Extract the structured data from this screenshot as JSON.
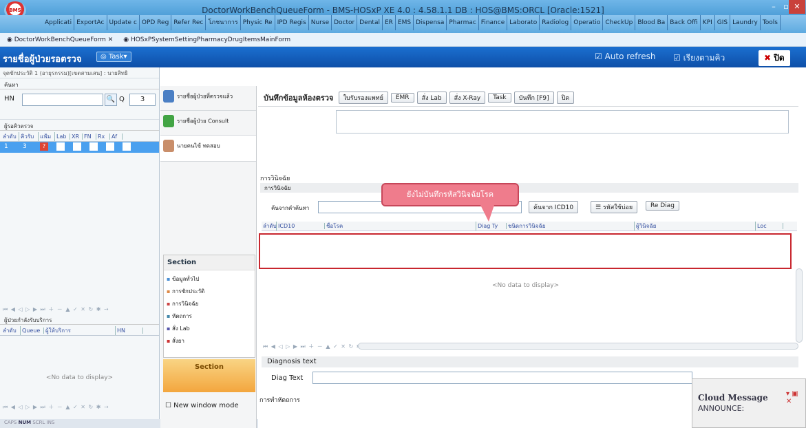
{
  "window": {
    "title": "DoctorWorkBenchQueueForm - BMS-HOSxP XE 4.0 : 4.58.1.1 DB : HOS@BMS:ORCL [Oracle:1521]",
    "logo": "BMS"
  },
  "menu": [
    "Applicati",
    "ExportAc",
    "Update c",
    "OPD Reg",
    "Refer Rec",
    "โภชนาการ",
    "Physic Re",
    "IPD Regis",
    "Nurse",
    "Doctor",
    "Dental",
    "ER",
    "EMS",
    "Dispensa",
    "Pharmac",
    "Finance",
    "Laborato",
    "Radiolog",
    "Operatio",
    "CheckUp",
    "Blood Ba",
    "Back Offi",
    "KPI",
    "GIS",
    "Laundry",
    "Tools"
  ],
  "doc_tabs": [
    "DoctorWorkBenchQueueForm",
    "HOSxPSystemSettingPharmacyDrugItemsMainForm"
  ],
  "header": {
    "title": "รายชื่อผู้ป่วยรอตรวจ",
    "task": "Task",
    "auto_refresh": "Auto refresh",
    "sort_queue": "เรียงตามคิว",
    "close": "ปิด"
  },
  "left": {
    "spclinic": "จุดซักประวัติ 1 (อายุรกรรม)[เขตสามเสน] : นายสิทธิ",
    "search": "ค้นหา",
    "hn_label": "HN",
    "q_label": "Q",
    "q_value": "3",
    "waiting": "ผู้รอคิวตรวจ",
    "grid_cols": [
      "ลำดับ",
      "คิวรับ",
      "แฟ้ม",
      "Lab",
      "XR",
      "FN",
      "Rx",
      "Af"
    ],
    "row": {
      "order": "1",
      "queue": "3"
    },
    "served": "ผู้ป่วยกำลังรับบริการ",
    "served_cols": [
      "ลำดับ",
      "Queue",
      "ผู้ให้บริการ",
      "HN"
    ],
    "no_data": "<No data to display>"
  },
  "status": [
    "CAPS",
    "NUM",
    "SCRL",
    "INS"
  ],
  "mid": {
    "items": [
      "รายชื่อผู้ป่วยที่ตรวจแล้ว",
      "รายชื่อผู้ป่วย Consult",
      "นายคนไข้ ทดสอบ"
    ],
    "section": "Section",
    "section_items": [
      "ข้อมูลทั่วไป",
      "การซักประวัติ",
      "การวินิจฉัย",
      "หัตถการ",
      "สั่ง Lab",
      "สั่งยา"
    ],
    "section_foot": "Section",
    "new_window": "New window mode"
  },
  "right": {
    "save_title": "บันทึกข้อมูลห้องตรวจ",
    "btns": [
      "ใบรับรองแพทย์",
      "EMR",
      "สั่ง Lab",
      "สั่ง X-Ray",
      "Task",
      "บันทึก [F9]",
      "ปิด"
    ],
    "dx_title": "การวินิจฉัย",
    "dx_sub": "การวินิจฉัย",
    "search_name": "ค้นจากคำค้นหา",
    "search_icd": "ค้นจาก ICD10",
    "common_code": "รหัสใช้บ่อย",
    "rediag": "Re Diag",
    "cols": [
      "ลำดับ",
      "ICD10",
      "ชื่อโรค",
      "Diag Ty",
      "ชนิดการวินิจฉัย",
      "ผู้วินิจฉัย",
      "Loc"
    ],
    "no_data": "<No data to display>",
    "dtext_title": "Diagnosis text",
    "dtext_label": "Diag Text",
    "proc_title": "การทำหัตถการ"
  },
  "annotation": "ยังไม่บันทึกรหัสวินิจฉัยโรค",
  "cloud": {
    "title": "Cloud Message",
    "body": "ANNOUNCE:"
  }
}
